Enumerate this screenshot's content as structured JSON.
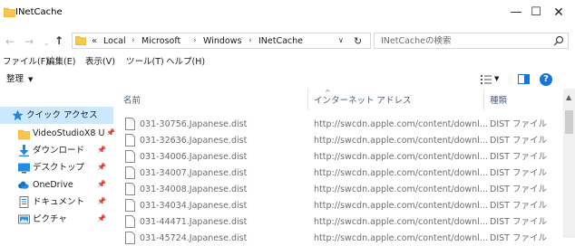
{
  "window": {
    "title": "INetCache",
    "min_glyph": "—",
    "max_glyph": "☐",
    "close_glyph": "✕"
  },
  "address": {
    "overflow": "«",
    "crumbs": [
      "Local",
      "Microsoft",
      "Windows",
      "INetCache"
    ],
    "separator": "›",
    "search_placeholder": "INetCacheの検索"
  },
  "menu": [
    "ファイル(F)",
    "編集(E)",
    "表示(V)",
    "ツール(T)",
    "ヘルプ(H)"
  ],
  "toolbar": {
    "organize_label": "整理",
    "help_glyph": "?"
  },
  "nav": {
    "items": [
      {
        "label": "クイック アクセス",
        "icon": "star-icon",
        "pinned": false,
        "selected": true
      },
      {
        "label": "VideoStudioX8 U",
        "icon": "folder-icon",
        "pinned": true,
        "selected": false
      },
      {
        "label": "ダウンロード",
        "icon": "download-icon",
        "pinned": true,
        "selected": false
      },
      {
        "label": "デスクトップ",
        "icon": "desktop-icon",
        "pinned": true,
        "selected": false
      },
      {
        "label": "OneDrive",
        "icon": "onedrive-icon",
        "pinned": true,
        "selected": false
      },
      {
        "label": "ドキュメント",
        "icon": "documents-icon",
        "pinned": true,
        "selected": false
      },
      {
        "label": "ピクチャ",
        "icon": "pictures-icon",
        "pinned": true,
        "selected": false
      }
    ],
    "pin_glyph": "📌"
  },
  "columns": {
    "name": "名前",
    "url": "インターネット アドレス",
    "type": "種類"
  },
  "files": [
    {
      "name": "031-30756.Japanese.dist",
      "url": "http://swcdn.apple.com/content/downl...",
      "type": "DIST ファイル"
    },
    {
      "name": "031-32636.Japanese.dist",
      "url": "http://swcdn.apple.com/content/downl...",
      "type": "DIST ファイル"
    },
    {
      "name": "031-34006.Japanese.dist",
      "url": "http://swcdn.apple.com/content/downl...",
      "type": "DIST ファイル"
    },
    {
      "name": "031-34007.Japanese.dist",
      "url": "http://swcdn.apple.com/content/downl...",
      "type": "DIST ファイル"
    },
    {
      "name": "031-34008.Japanese.dist",
      "url": "http://swcdn.apple.com/content/downl...",
      "type": "DIST ファイル"
    },
    {
      "name": "031-34034.Japanese.dist",
      "url": "http://swcdn.apple.com/content/downl...",
      "type": "DIST ファイル"
    },
    {
      "name": "031-44471.Japanese.dist",
      "url": "http://swcdn.apple.com/content/downl...",
      "type": "DIST ファイル"
    },
    {
      "name": "031-45724.Japanese.dist",
      "url": "http://swcdn.apple.com/content/downl...",
      "type": "DIST ファイル"
    }
  ],
  "colors": {
    "folder": "#f8c74a",
    "accent": "#1a74d8",
    "selected_bg": "#cce8ff",
    "header_text": "#4c607a"
  }
}
